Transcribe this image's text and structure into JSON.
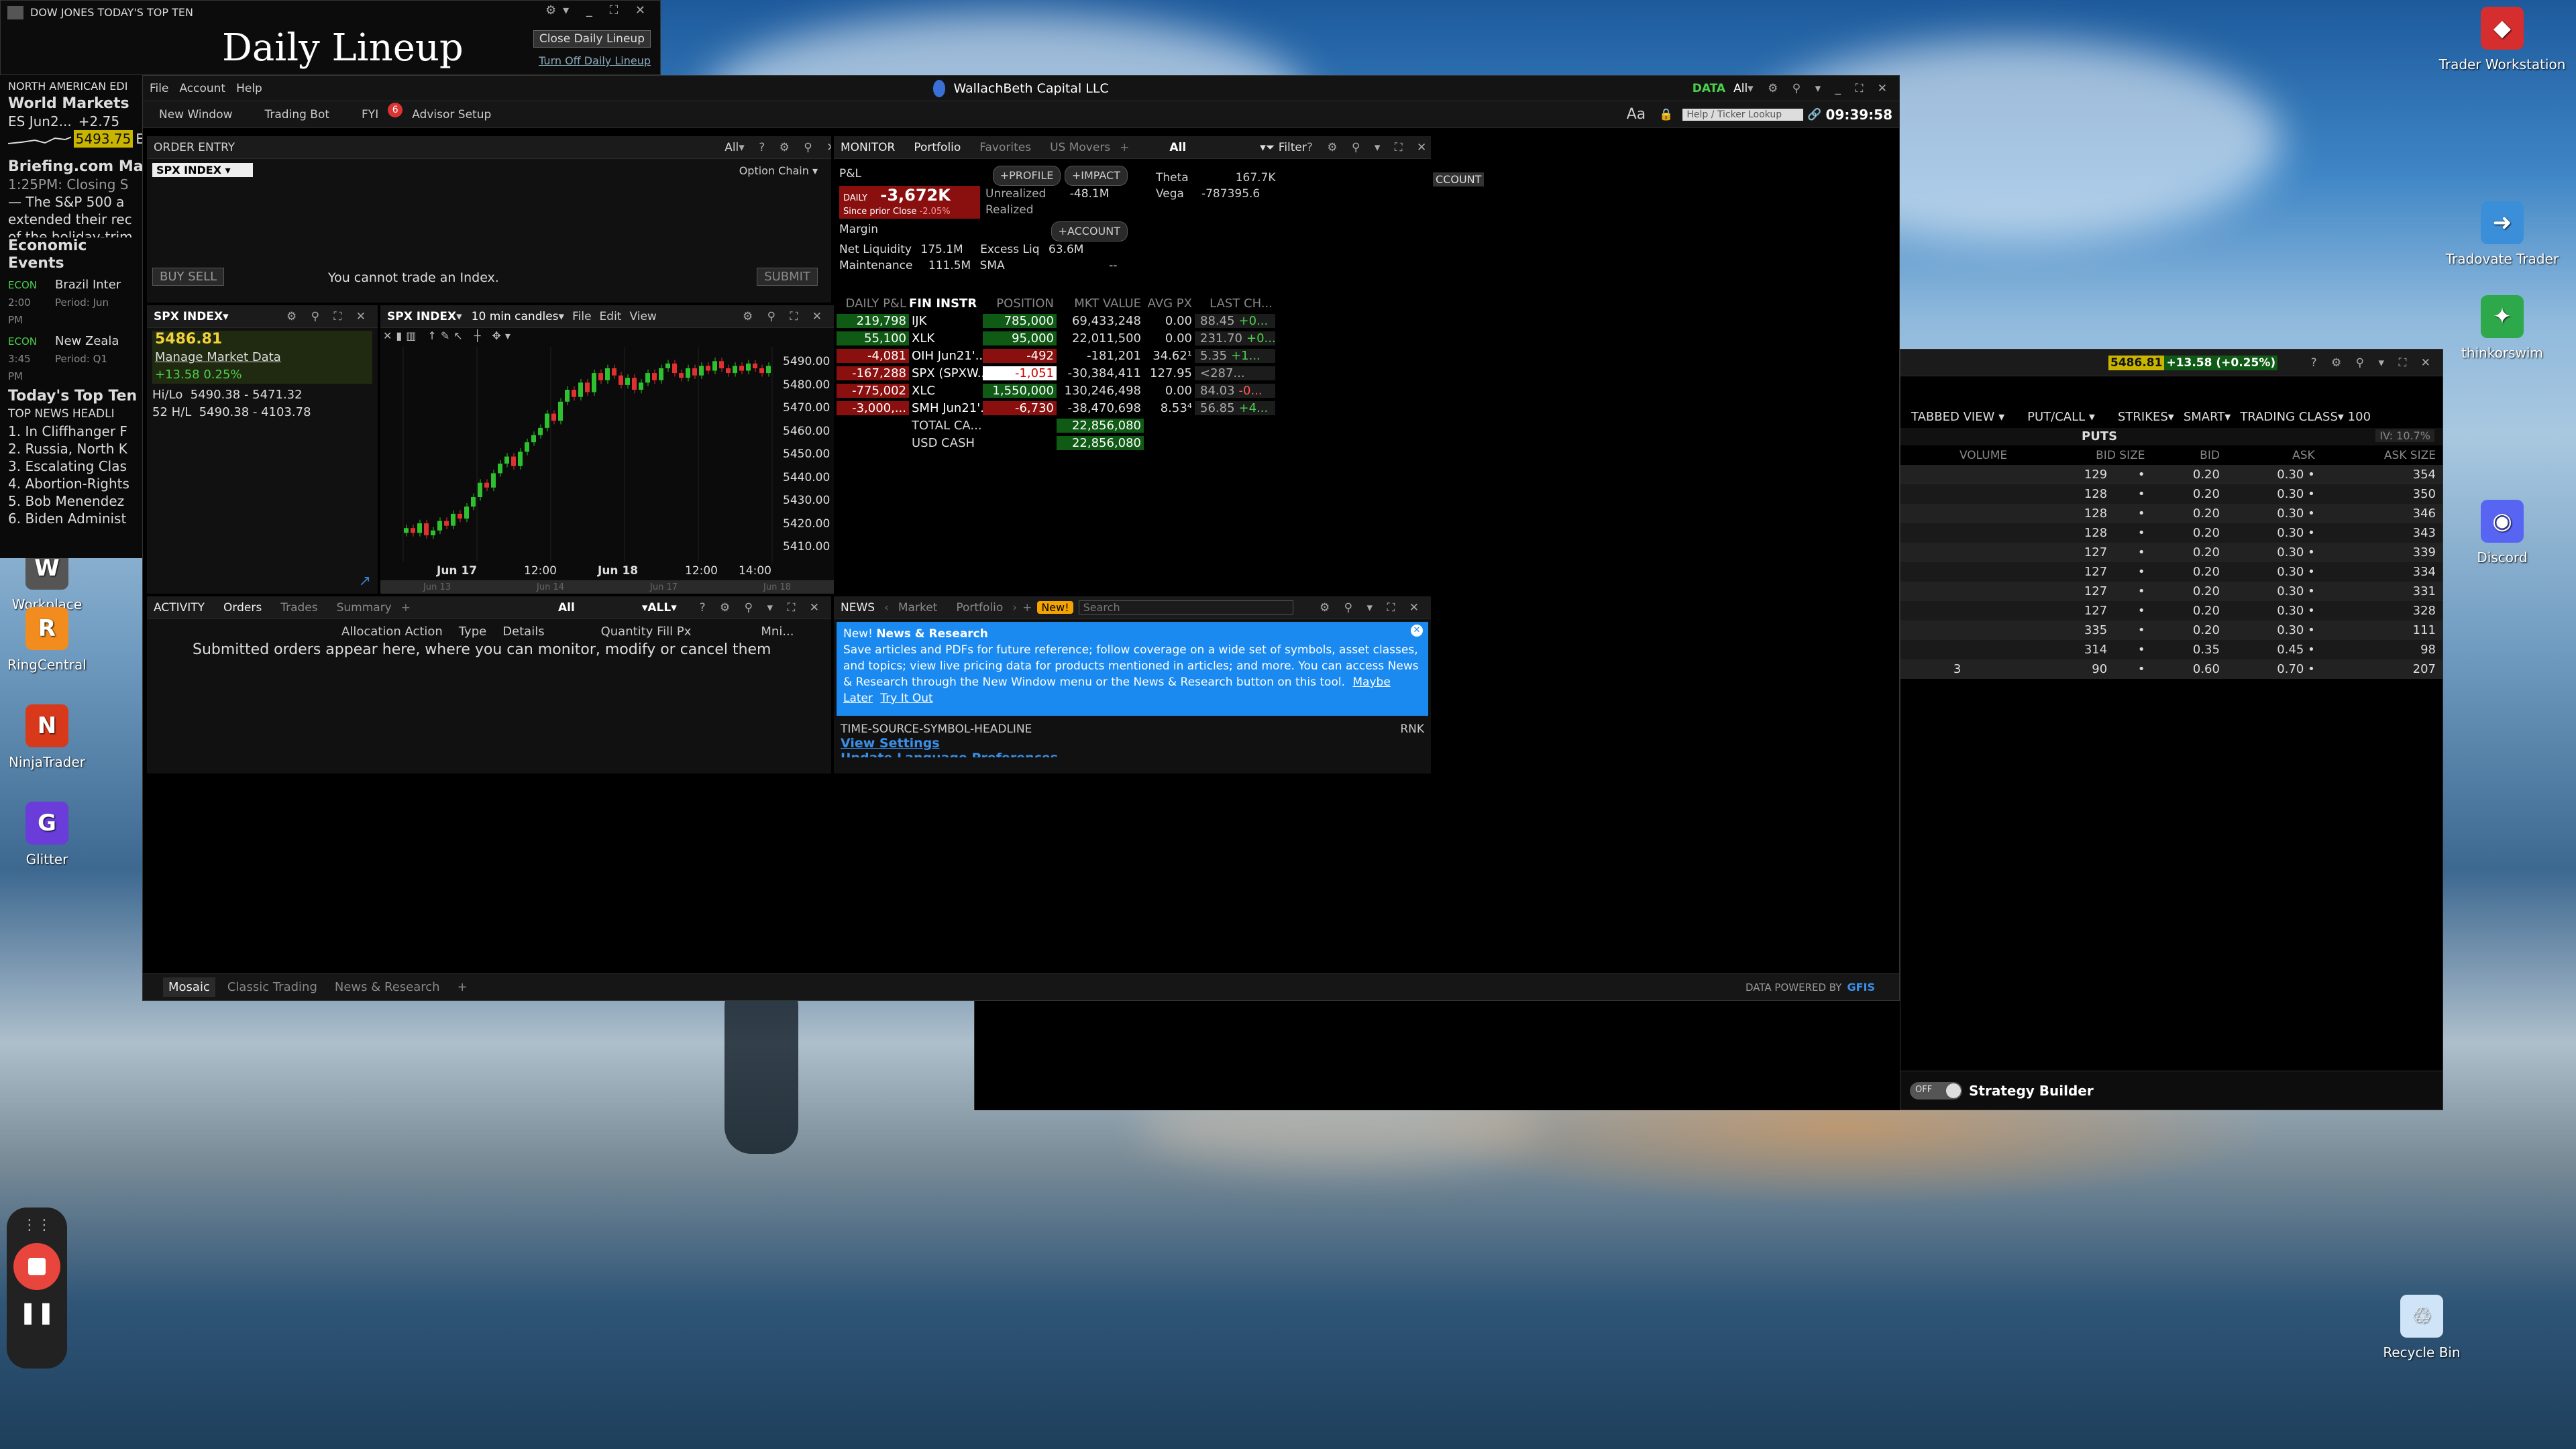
{
  "desktop": {
    "icons": [
      {
        "label": "Trader Workstation",
        "icon": "trader-workstation-icon",
        "color": "#d62e2e"
      },
      {
        "label": "Tradovate Trader",
        "icon": "tradovate-icon",
        "color": "#3a8fd8"
      },
      {
        "label": "thinkorswim",
        "icon": "thinkorswim-icon",
        "color": "#2da84a"
      },
      {
        "label": "Discord",
        "icon": "discord-icon",
        "color": "#5865f2"
      },
      {
        "label": "Recycle Bin",
        "icon": "recycle-bin-icon",
        "color": "#cfe4f6"
      },
      {
        "label": "Workplace",
        "icon": "workplace-icon",
        "color": "#555"
      },
      {
        "label": "RingCentral",
        "icon": "ringcentral-icon",
        "color": "#f28c1e"
      },
      {
        "label": "NinjaTrader",
        "icon": "ninjatrader-icon",
        "color": "#d9391b"
      },
      {
        "label": "Glitter",
        "icon": "glitter-icon",
        "color": "#6a3cd9"
      }
    ]
  },
  "lineup": {
    "source": "DOW JONES TODAY'S TOP TEN",
    "title": "Daily Lineup",
    "close": "Close Daily Lineup",
    "turn_off": "Turn Off Daily Lineup"
  },
  "left": {
    "edition": "NORTH AMERICAN EDI",
    "world": "World Markets",
    "es": "ES Jun2...",
    "es_change": "+2.75",
    "es_price": "5493.75",
    "es_suffix": "E",
    "briefing": "Briefing.com Ma",
    "brief_time": "1:25PM: Closing S",
    "brief_l1": "— The S&P 500 a",
    "brief_l2": "extended their rec",
    "brief_l3": "of the holiday-trim",
    "econ": "Economic Events",
    "e1_tag": "ECON",
    "e1_time": "2:00 PM",
    "e1_title": "Brazil Inter",
    "e1_period": "Period: Jun",
    "e2_tag": "ECON",
    "e2_time": "3:45 PM",
    "e2_title": "New Zeala",
    "e2_period": "Period: Q1",
    "topten": "Today's Top Ten",
    "headl": "TOP NEWS HEADLI",
    "news": [
      "1.  In Cliffhanger F",
      "2.  Russia, North K",
      "3.  Escalating Clas",
      "4.  Abortion-Rights",
      "5.  Bob Menendez",
      "6.  Biden Administ"
    ]
  },
  "main": {
    "title": "WallachBeth Capital LLC",
    "menu": [
      "File",
      "Account",
      "Help"
    ],
    "data_label": "DATA",
    "data_val": "All",
    "toolbar": [
      "New Window",
      "Trading Bot",
      "FYI",
      "Advisor Setup"
    ],
    "fyi_badge": "6",
    "font": "Aa",
    "search_ph": "Help / Ticker Lookup",
    "time": "09:39:58",
    "bottom_tabs": [
      "Mosaic",
      "Classic Trading",
      "News & Research"
    ],
    "powered": "DATA POWERED BY",
    "gfis": "GFIS"
  },
  "order": {
    "title": "ORDER ENTRY",
    "all": "All",
    "symbol": "SPX INDEX",
    "chain": "Option Chain",
    "buy": "BUY",
    "sell": "SELL",
    "msg": "You cannot trade an Index.",
    "submit": "SUBMIT"
  },
  "quote": {
    "symbol": "SPX INDEX",
    "price": "5486.81",
    "link": "Manage Market Data",
    "chg": "+13.58",
    "pct": "0.25%",
    "hilo_label": "Hi/Lo",
    "hilo": "5490.38 - 5471.32",
    "h52_label": "52 H/L",
    "h52": "5490.38 - 4103.78"
  },
  "chart": {
    "symbol": "SPX INDEX",
    "interval": "10 min candles",
    "menus": [
      "File",
      "Edit",
      "View"
    ],
    "yticks": [
      "5490.00",
      "5480.00",
      "5470.00",
      "5460.00",
      "5450.00",
      "5440.00",
      "5430.00",
      "5420.00",
      "5410.00"
    ],
    "xticks": [
      "Jun 17",
      "12:00",
      "Jun 18",
      "12:00",
      "14:00"
    ],
    "nav": [
      "Jun 13",
      "Jun 14",
      "Jun 17",
      "Jun 18"
    ]
  },
  "chart_data": {
    "type": "candlestick",
    "ylim": [
      5405,
      5495
    ],
    "closes": [
      5419,
      5417,
      5421,
      5416,
      5418,
      5422,
      5420,
      5425,
      5423,
      5428,
      5432,
      5438,
      5436,
      5442,
      5446,
      5449,
      5445,
      5451,
      5455,
      5458,
      5461,
      5467,
      5464,
      5472,
      5477,
      5474,
      5480,
      5476,
      5484,
      5481,
      5486,
      5483,
      5479,
      5482,
      5477,
      5480,
      5484,
      5481,
      5486,
      5488,
      5484,
      5482,
      5486,
      5483,
      5487,
      5485,
      5489,
      5486,
      5484,
      5487,
      5485,
      5488,
      5486,
      5484,
      5487
    ]
  },
  "monitor": {
    "tabs": [
      "MONITOR",
      "Portfolio",
      "Favorites",
      "US Movers"
    ],
    "all": "All",
    "filter": "Filter",
    "pnl": "P&L",
    "profile": "PROFILE",
    "impact": "IMPACT",
    "daily": "DAILY",
    "daily_val": "-3,672K",
    "since": "Since prior Close",
    "since_pct": "-2.05%",
    "unreal": "Unrealized",
    "unreal_val": "-48.1M",
    "realized": "Realized",
    "theta": "Theta",
    "theta_val": "167.7K",
    "vega": "Vega",
    "vega_val": "-787395.6",
    "margin": "Margin",
    "account": "ACCOUNT",
    "account_tag": "CCOUNT",
    "netliq": "Net Liquidity",
    "netliq_val": "175.1M",
    "excess": "Excess Liq",
    "excess_val": "63.6M",
    "maint": "Maintenance",
    "maint_val": "111.5M",
    "sma": "SMA",
    "sma_val": "--",
    "cols": [
      "DAILY P&L",
      "FIN INSTR",
      "POSITION",
      "MKT VALUE",
      "AVG PX",
      "LAST CH..."
    ],
    "rows": [
      [
        "219,798",
        "IJK",
        "785,000",
        "69,433,248",
        "0.00",
        "88.45",
        "+0...",
        "g"
      ],
      [
        "55,100",
        "XLK",
        "95,000",
        "22,011,500",
        "0.00",
        "231.70",
        "+0...",
        "g"
      ],
      [
        "-4,081",
        "OIH Jun21'...",
        "-492",
        "-181,201",
        "34.62¹",
        "5.35",
        "+1...",
        "r"
      ],
      [
        "-167,288",
        "SPX (SPXW...",
        "-1,051",
        "-30,384,411",
        "127.95",
        "<287...",
        "",
        "r"
      ],
      [
        "-775,002",
        "XLC",
        "1,550,000",
        "130,246,498",
        "0.00",
        "84.03",
        "-0...",
        "r"
      ],
      [
        "-3,000,...",
        "SMH Jun21'...",
        "-6,730",
        "-38,470,698",
        "8.53⁴",
        "56.85",
        "+4...",
        "r"
      ]
    ],
    "total_label": "TOTAL CA...",
    "total_val": "22,856,080",
    "cash_label": "USD CASH",
    "cash_val": "22,856,080"
  },
  "activity": {
    "tabs": [
      "ACTIVITY",
      "Orders",
      "Trades",
      "Summary"
    ],
    "all": "All",
    "all2": "ALL",
    "cols": [
      "Allocation Action",
      "Type",
      "Details",
      "Quantity Fill Px",
      "Mni..."
    ],
    "empty": "Submitted orders appear here, where you can monitor, modify or cancel them"
  },
  "news": {
    "tabs": [
      "NEWS",
      "Market",
      "Portfolio"
    ],
    "new": "New!",
    "search": "Search",
    "banner_new": "New!",
    "banner_title": "News & Research",
    "banner_text": "Save articles and PDFs for future reference; follow coverage on a wide set of symbols, asset classes, and topics; view live pricing data for products mentioned in articles; and more. You can access News & Research through the New Window menu or the News & Research button on this tool.",
    "later": "Maybe Later",
    "try": "Try It Out",
    "cols": "TIME-SOURCE-SYMBOL-HEADLINE",
    "rnk": "RNK",
    "view": "View Settings",
    "lang": "Update Language Preferences"
  },
  "optchain": {
    "price": "5486.81",
    "chg": "+13.58 (+0.25%)",
    "tabbed": "TABBED VIEW",
    "putcall": "PUT/CALL",
    "strikes": "STRIKES",
    "smart": "SMART",
    "tclass": "TRADING CLASS",
    "tnum": "100",
    "puts": "PUTS",
    "iv": "IV: 10.7%",
    "cols": [
      "VOLUME",
      "BID SIZE",
      "BID",
      "ASK",
      "ASK SIZE"
    ],
    "rows": [
      [
        "",
        "129",
        "0.20",
        "0.30",
        "354"
      ],
      [
        "",
        "128",
        "0.20",
        "0.30",
        "350"
      ],
      [
        "",
        "128",
        "0.20",
        "0.30",
        "346"
      ],
      [
        "",
        "128",
        "0.20",
        "0.30",
        "343"
      ],
      [
        "",
        "127",
        "0.20",
        "0.30",
        "339"
      ],
      [
        "",
        "127",
        "0.20",
        "0.30",
        "334"
      ],
      [
        "",
        "127",
        "0.20",
        "0.30",
        "331"
      ],
      [
        "",
        "127",
        "0.20",
        "0.30",
        "328"
      ],
      [
        "",
        "335",
        "0.20",
        "0.30",
        "111"
      ],
      [
        "",
        "314",
        "0.35",
        "0.45",
        "98"
      ],
      [
        "3",
        "90",
        "0.60",
        "0.70",
        "207"
      ]
    ],
    "off": "OFF",
    "strategy": "Strategy Builder"
  }
}
